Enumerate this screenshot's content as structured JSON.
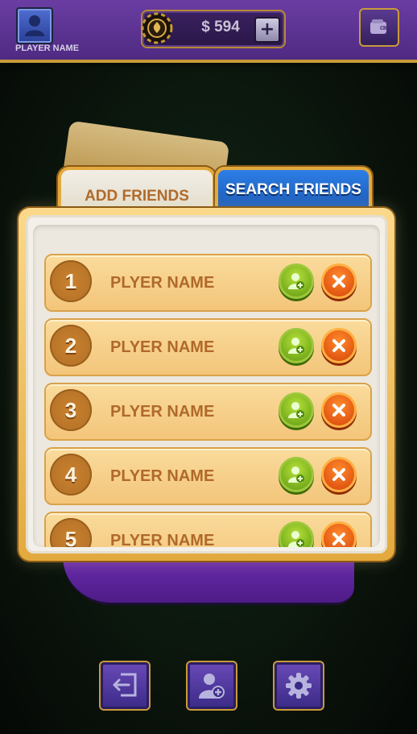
{
  "header": {
    "player_name": "PLAYER NAME",
    "coins": "$ 594",
    "add_coins_label": "+"
  },
  "tabs": [
    {
      "label": "ADD FRIENDS",
      "active": true
    },
    {
      "label": "SEARCH FRIENDS",
      "active": false
    }
  ],
  "requests": [
    {
      "rank": "1",
      "name": "PLYER NAME"
    },
    {
      "rank": "2",
      "name": "PLYER NAME"
    },
    {
      "rank": "3",
      "name": "PLYER NAME"
    },
    {
      "rank": "4",
      "name": "PLYER NAME"
    },
    {
      "rank": "5",
      "name": "PLYER NAME"
    }
  ],
  "icons": {
    "avatar": "user-icon",
    "chip": "poker-chip-icon",
    "wallet": "wallet-icon",
    "accept": "add-user-icon",
    "decline": "close-icon",
    "exit": "exit-icon",
    "friends": "add-friend-icon",
    "settings": "gear-icon"
  },
  "colors": {
    "header_bg": "#5b3391",
    "gold": "#e3a93d",
    "tab_active_text": "#b0692a",
    "tab_inactive_bg": "#1f6bd0",
    "accept": "#7db51c",
    "decline": "#e8550f"
  }
}
